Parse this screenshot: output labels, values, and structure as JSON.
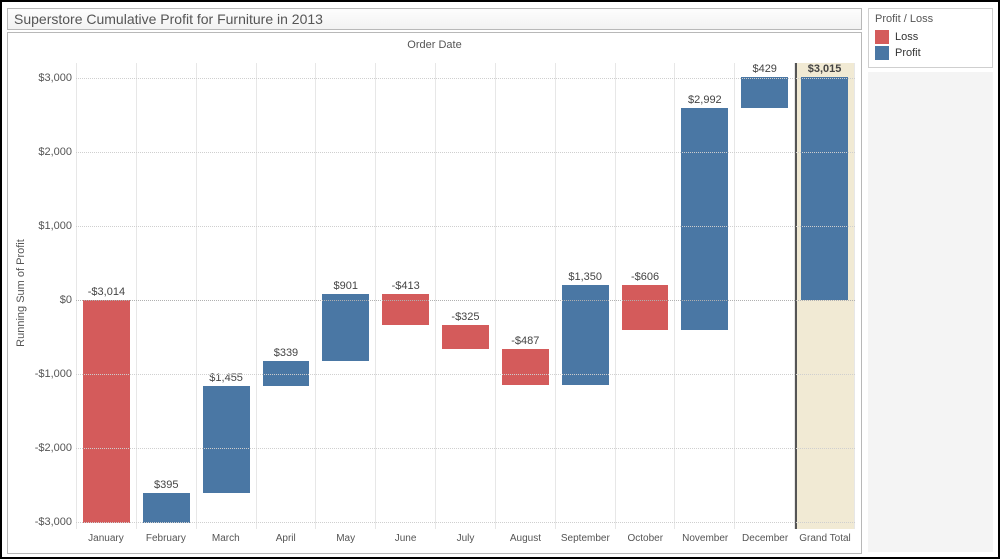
{
  "title": "Superstore Cumulative Profit for Furniture in 2013",
  "x_axis_title": "Order Date",
  "y_axis_title": "Running Sum of Profit",
  "legend": {
    "title": "Profit / Loss",
    "loss_label": "Loss",
    "profit_label": "Profit"
  },
  "colors": {
    "loss": "#d45b5b",
    "profit": "#4a77a4"
  },
  "y_ticks": [
    {
      "value": 3000,
      "label": "$3,000"
    },
    {
      "value": 2000,
      "label": "$2,000"
    },
    {
      "value": 1000,
      "label": "$1,000"
    },
    {
      "value": 0,
      "label": "$0"
    },
    {
      "value": -1000,
      "label": "-$1,000"
    },
    {
      "value": -2000,
      "label": "-$2,000"
    },
    {
      "value": -3000,
      "label": "-$3,000"
    }
  ],
  "months": [
    {
      "name": "January",
      "label": "-$3,014",
      "delta": -3014,
      "start": 0,
      "end": -3014,
      "type": "loss"
    },
    {
      "name": "February",
      "label": "$395",
      "delta": 395,
      "start": -3014,
      "end": -2619,
      "type": "profit"
    },
    {
      "name": "March",
      "label": "$1,455",
      "delta": 1455,
      "start": -2619,
      "end": -1164,
      "type": "profit"
    },
    {
      "name": "April",
      "label": "$339",
      "delta": 339,
      "start": -1164,
      "end": -825,
      "type": "profit"
    },
    {
      "name": "May",
      "label": "$901",
      "delta": 901,
      "start": -825,
      "end": 76,
      "type": "profit"
    },
    {
      "name": "June",
      "label": "-$413",
      "delta": -413,
      "start": 76,
      "end": -337,
      "type": "loss"
    },
    {
      "name": "July",
      "label": "-$325",
      "delta": -325,
      "start": -337,
      "end": -662,
      "type": "loss"
    },
    {
      "name": "August",
      "label": "-$487",
      "delta": -487,
      "start": -662,
      "end": -1149,
      "type": "loss"
    },
    {
      "name": "September",
      "label": "$1,350",
      "delta": 1350,
      "start": -1149,
      "end": 201,
      "type": "profit"
    },
    {
      "name": "October",
      "label": "-$606",
      "delta": -606,
      "start": 201,
      "end": -405,
      "type": "loss"
    },
    {
      "name": "November",
      "label": "$2,992",
      "delta": 2992,
      "start": -405,
      "end": 2587,
      "type": "profit"
    },
    {
      "name": "December",
      "label": "$429",
      "delta": 429,
      "start": 2587,
      "end": 3016,
      "type": "profit"
    }
  ],
  "grand_total": {
    "name": "Grand Total",
    "label": "$3,015",
    "value": 3015,
    "type": "profit"
  },
  "chart_data": {
    "type": "bar",
    "subtype": "waterfall",
    "title": "Superstore Cumulative Profit for Furniture in 2013",
    "xlabel": "Order Date",
    "ylabel": "Running Sum of Profit",
    "ylim": [
      -3100,
      3200
    ],
    "categories": [
      "January",
      "February",
      "March",
      "April",
      "May",
      "June",
      "July",
      "August",
      "September",
      "October",
      "November",
      "December",
      "Grand Total"
    ],
    "values": [
      -3014,
      395,
      1455,
      339,
      901,
      -413,
      -325,
      -487,
      1350,
      -606,
      2992,
      429,
      3015
    ],
    "running_sum": [
      -3014,
      -2619,
      -1164,
      -825,
      76,
      -337,
      -662,
      -1149,
      201,
      -405,
      2587,
      3016,
      3015
    ],
    "series": [
      {
        "name": "Loss",
        "color": "#d45b5b"
      },
      {
        "name": "Profit",
        "color": "#4a77a4"
      }
    ]
  }
}
